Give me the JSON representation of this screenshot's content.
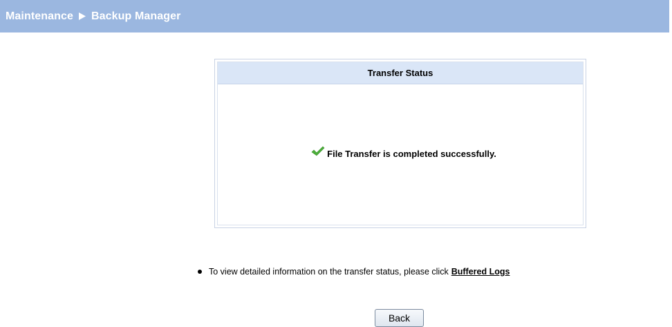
{
  "header": {
    "section": "Maintenance",
    "page": "Backup Manager"
  },
  "status_panel": {
    "title": "Transfer Status",
    "message": "File Transfer is completed successfully."
  },
  "info": {
    "text": "To view detailed information on the transfer status, please click",
    "link_label": "Buffered Logs"
  },
  "actions": {
    "back_label": "Back"
  },
  "icons": {
    "separator": "triangle-right-icon",
    "status": "checkmark-icon"
  },
  "colors": {
    "header_bg": "#9bb7e0",
    "panel_title_bg": "#dae6f7",
    "success_check": "#4caf3a"
  }
}
